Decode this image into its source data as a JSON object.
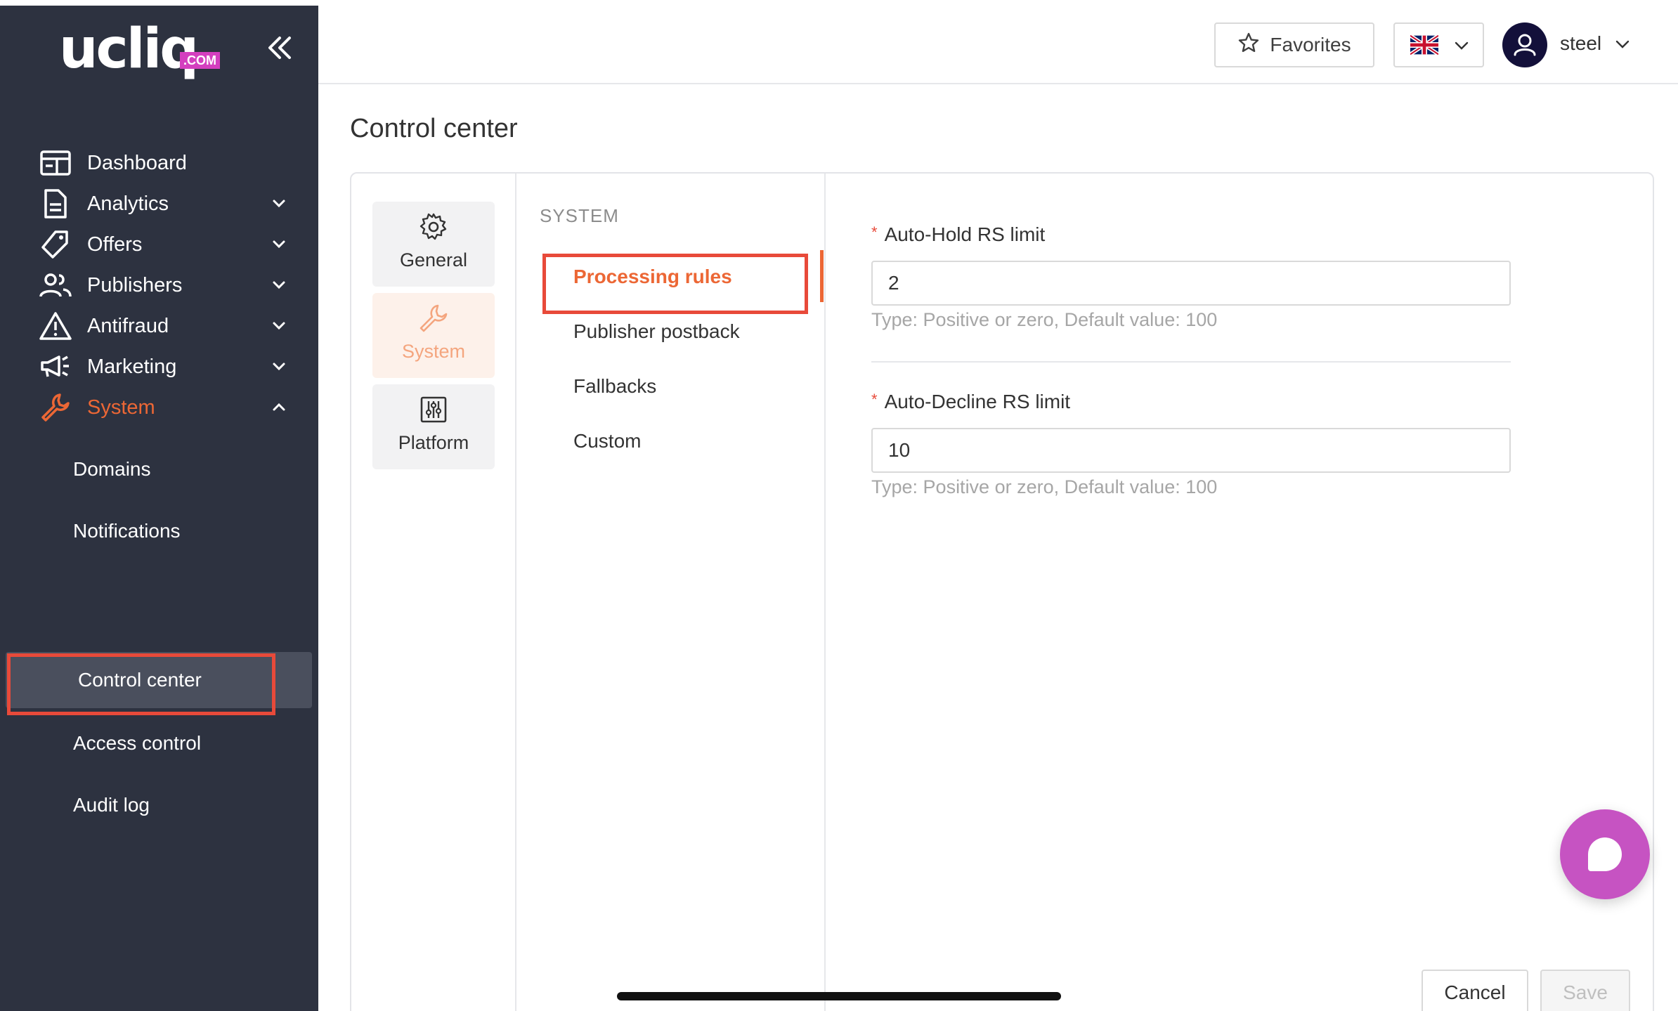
{
  "brand": {
    "name": "ucliq",
    "badge": ".COM",
    "accent": "#ec6735",
    "sidebar_bg": "#2d3240",
    "badge_color": "#d43fbf"
  },
  "sidebar": {
    "items": [
      {
        "label": "Dashboard",
        "icon": "dashboard-icon"
      },
      {
        "label": "Analytics",
        "icon": "document-icon"
      },
      {
        "label": "Offers",
        "icon": "tag-icon"
      },
      {
        "label": "Publishers",
        "icon": "users-icon"
      },
      {
        "label": "Antifraud",
        "icon": "warning-icon"
      },
      {
        "label": "Marketing",
        "icon": "megaphone-icon"
      },
      {
        "label": "System",
        "icon": "wrench-icon",
        "expanded": true
      }
    ],
    "system_children": [
      {
        "label": "Domains"
      },
      {
        "label": "Notifications"
      },
      {
        "label": "Control center",
        "selected": true
      },
      {
        "label": "Access control"
      },
      {
        "label": "Audit log"
      }
    ]
  },
  "header": {
    "favorites_label": "Favorites",
    "language": "English (UK flag)",
    "user_name": "steel"
  },
  "page": {
    "title": "Control center",
    "categories": [
      {
        "label": "General",
        "icon": "gear-icon"
      },
      {
        "label": "System",
        "icon": "wrench-icon",
        "active": true
      },
      {
        "label": "Platform",
        "icon": "sliders-icon"
      }
    ],
    "section_heading": "SYSTEM",
    "submenu": [
      {
        "label": "Processing rules",
        "active": true
      },
      {
        "label": "Publisher postback"
      },
      {
        "label": "Fallbacks"
      },
      {
        "label": "Custom"
      }
    ],
    "fields": [
      {
        "label": "Auto-Hold RS limit",
        "required": "*",
        "value": "2",
        "help": "Type: Positive or zero,  Default value: 100"
      },
      {
        "label": "Auto-Decline RS limit",
        "required": "*",
        "value": "10",
        "help": "Type: Positive or zero,  Default value: 100"
      }
    ],
    "actions": {
      "cancel": "Cancel",
      "save": "Save"
    }
  }
}
